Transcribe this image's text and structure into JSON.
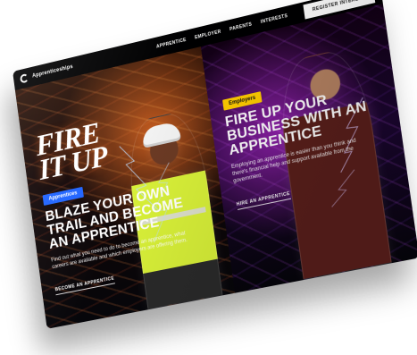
{
  "brand": {
    "name": "Apprenticeships"
  },
  "nav": {
    "items": [
      "APPRENTICE",
      "EMPLOYER",
      "PARENTS",
      "INTERESTS"
    ],
    "register": "REGISTER INTEREST"
  },
  "left": {
    "hero_lines": [
      "FIRE",
      "IT UP"
    ],
    "tag": "Apprentices",
    "headline_lines": [
      "BLAZE YOUR OWN",
      "TRAIL AND BECOME",
      "AN APPRENTICE"
    ],
    "body": "Find out what you need to do to become an apprentice, what careers are available and which employers are offering them.",
    "cta": "BECOME AN APPRENTICE"
  },
  "right": {
    "tag": "Employers",
    "headline_lines": [
      "FIRE UP YOUR",
      "BUSINESS WITH AN",
      "APPRENTICE"
    ],
    "body": "Employing an apprentice is easier than you think and there's financial help and support available from the government.",
    "cta": "HIRE AN APPRENTICE"
  },
  "colors": {
    "blue": "#1e63ff",
    "yellow": "#ffcc00",
    "hero_glow": "#ff6e1e"
  },
  "icons": {
    "logo": "apprenticeships-logo"
  }
}
